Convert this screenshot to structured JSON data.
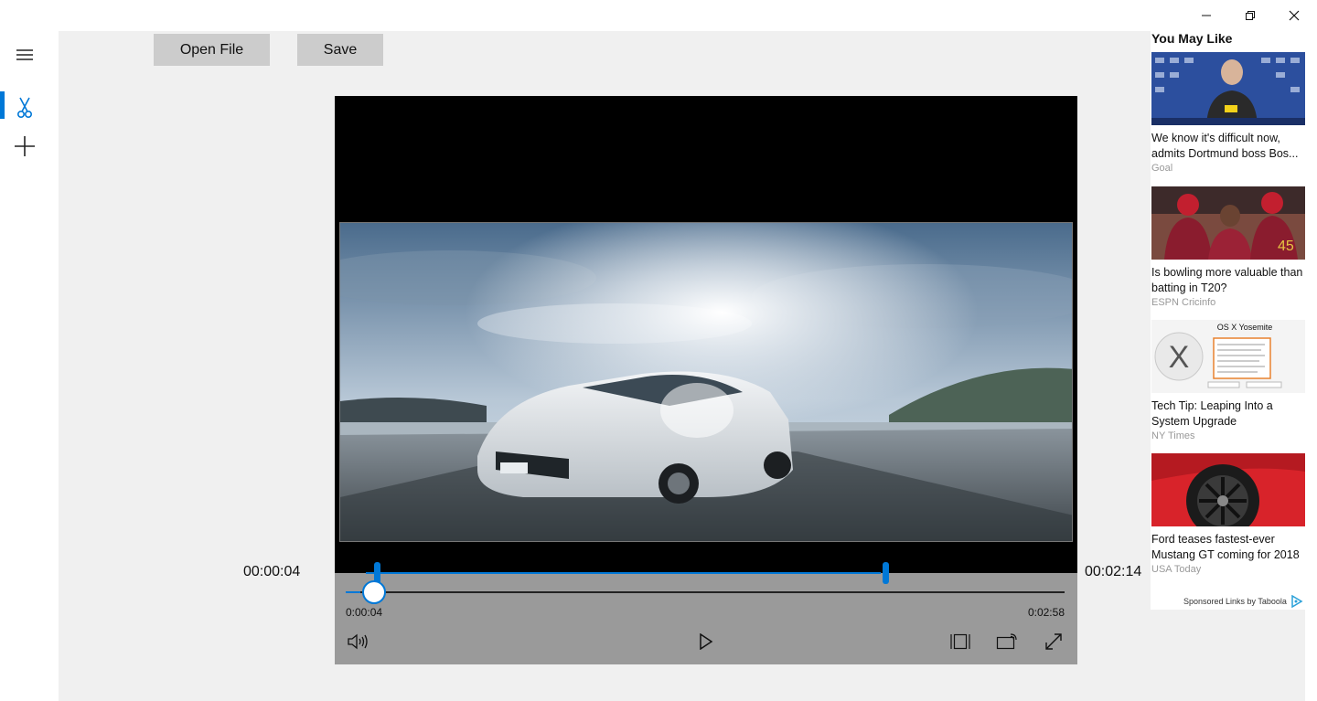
{
  "window": {
    "controls": [
      "minimize",
      "restore",
      "close"
    ]
  },
  "nav": {
    "items": [
      {
        "icon": "hamburger-menu-icon"
      },
      {
        "icon": "scissors-icon",
        "active": true
      },
      {
        "icon": "plus-icon"
      }
    ],
    "accent_color": "#0078d7"
  },
  "toolbar": {
    "open_label": "Open File",
    "save_label": "Save"
  },
  "trim": {
    "start_time": "00:00:04",
    "end_time": "00:02:14"
  },
  "player": {
    "current_time": "0:00:04",
    "duration": "0:02:58",
    "progress_fraction": 0.02,
    "trim_start_fraction": 0.02,
    "trim_end_fraction": 0.75
  },
  "sidebar": {
    "title": "You May Like",
    "cards": [
      {
        "headline": "We know it's difficult now, admits Dortmund boss Bos...",
        "source": "Goal"
      },
      {
        "headline": "Is bowling more valuable than batting in T20?",
        "source": "ESPN Cricinfo"
      },
      {
        "headline": "Tech Tip: Leaping Into a System Upgrade",
        "source": "NY Times"
      },
      {
        "headline": "Ford teases fastest-ever Mustang GT coming for 2018",
        "source": "USA Today"
      }
    ],
    "sponsor_label": "Sponsored Links by Taboola",
    "thumb3_title": "OS X Yosemite"
  }
}
